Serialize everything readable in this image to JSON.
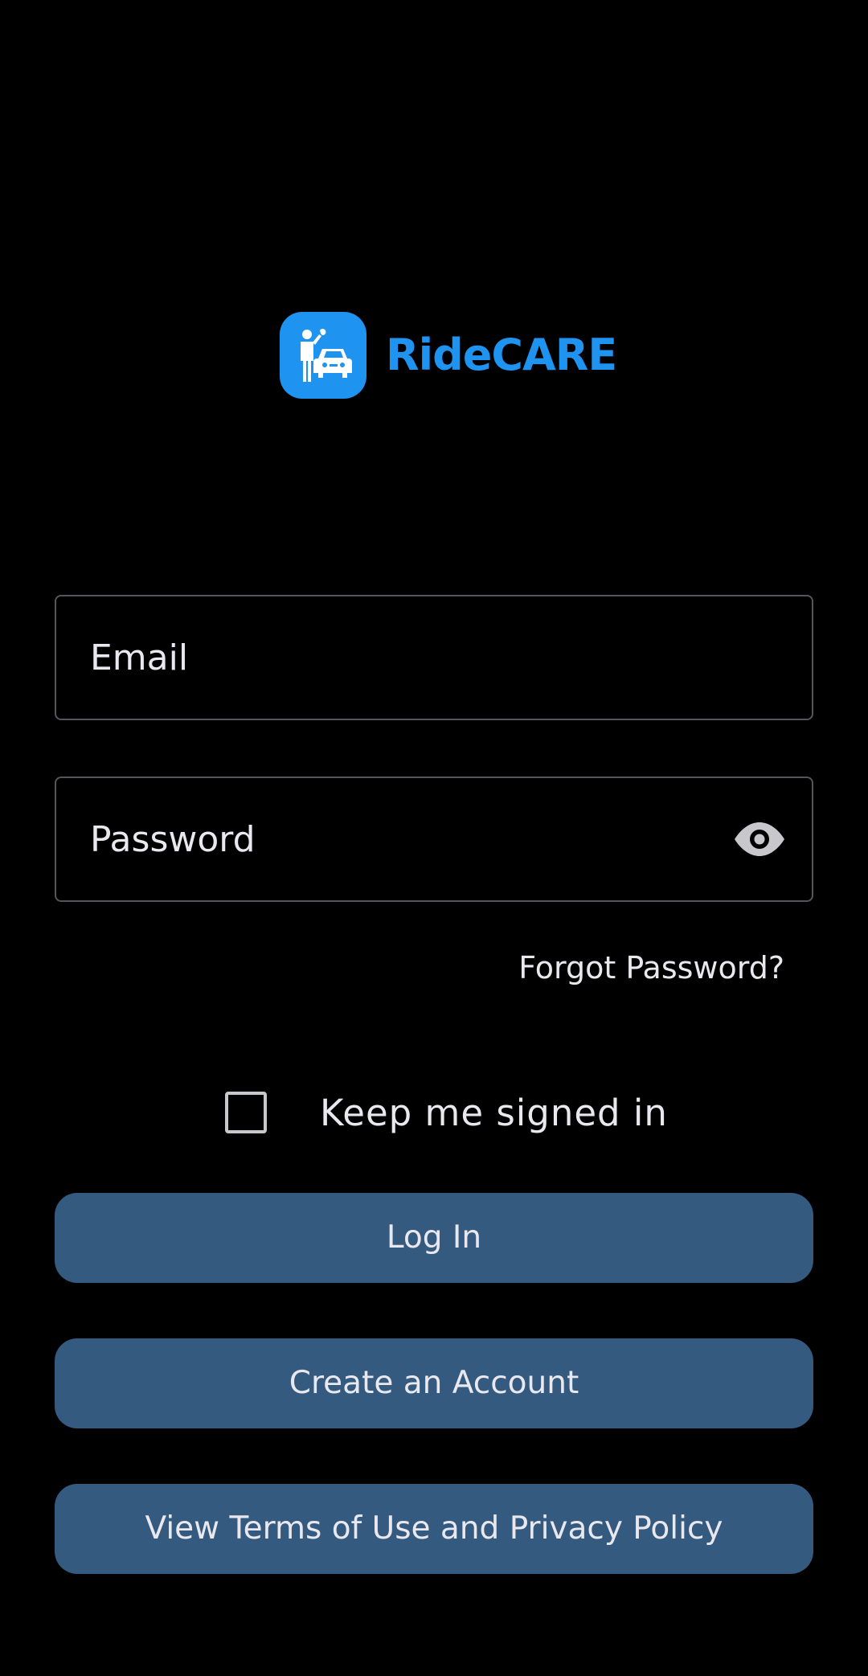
{
  "brand": {
    "name": "RideCARE",
    "logo_icon": "mechanic-car-icon",
    "color": "#1f93f0"
  },
  "form": {
    "email_placeholder": "Email",
    "password_placeholder": "Password",
    "password_toggle_icon": "eye-icon",
    "forgot_password": "Forgot Password?",
    "keep_signed_in": "Keep me signed in",
    "keep_signed_in_checked": false
  },
  "buttons": {
    "login": "Log In",
    "create_account": "Create an Account",
    "terms": "View Terms of Use and Privacy Policy",
    "color": "#355a80"
  }
}
